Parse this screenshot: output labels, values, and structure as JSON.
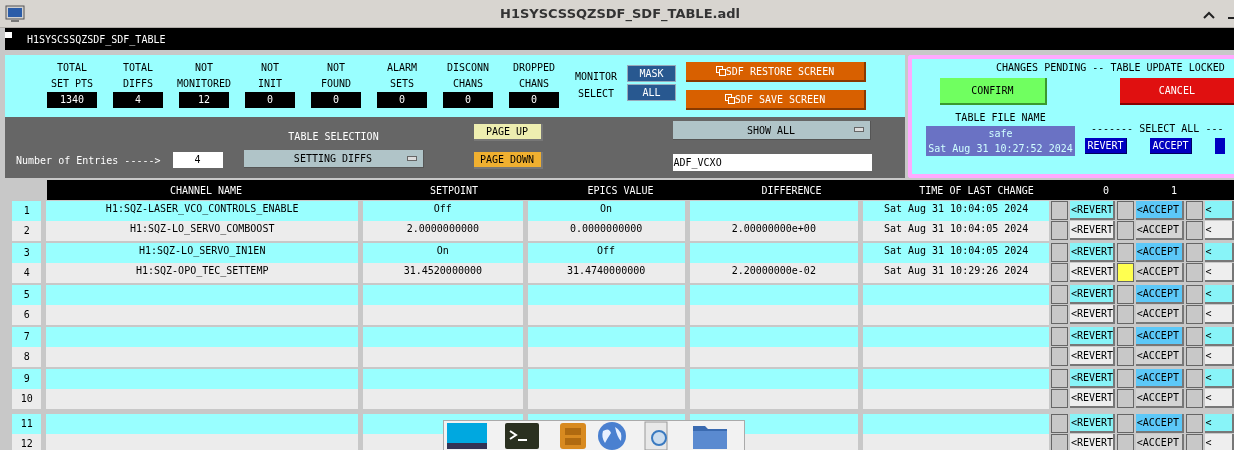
{
  "window": {
    "title": "H1SYSCSSQZSDF_SDF_TABLE.adl"
  },
  "screen_title": "H1SYSCSSQZSDF_SDF_TABLE",
  "counters": [
    {
      "label_lines": [
        "TOTAL",
        "SET PTS"
      ],
      "value": "1340"
    },
    {
      "label_lines": [
        "TOTAL",
        "DIFFS"
      ],
      "value": "4"
    },
    {
      "label_lines": [
        "NOT",
        "MONITORED"
      ],
      "value": "12"
    },
    {
      "label_lines": [
        "NOT",
        "INIT"
      ],
      "value": "0"
    },
    {
      "label_lines": [
        "NOT",
        "FOUND"
      ],
      "value": "0"
    },
    {
      "label_lines": [
        "ALARM",
        "SETS"
      ],
      "value": "0"
    },
    {
      "label_lines": [
        "DISCONN",
        "CHANS"
      ],
      "value": "0"
    },
    {
      "label_lines": [
        "DROPPED",
        "CHANS"
      ],
      "value": "0"
    }
  ],
  "monitor_select": {
    "label_lines": [
      "MONITOR",
      "SELECT"
    ],
    "buttons": [
      "MASK",
      "ALL"
    ]
  },
  "screen_buttons": [
    "SDF RESTORE SCREEN",
    "SDF SAVE SCREEN"
  ],
  "entries": {
    "label": "Number of Entries ----->",
    "value": "4"
  },
  "table_selection": {
    "label": "TABLE SELECTION",
    "value": "SETTING DIFFS"
  },
  "page_buttons": [
    {
      "label": "PAGE UP",
      "kind": "up"
    },
    {
      "label": "PAGE DOWN",
      "kind": "down"
    }
  ],
  "show_menu": {
    "value": "SHOW ALL"
  },
  "filter_field": {
    "value": "ADF_VCXO"
  },
  "pending": {
    "message": "CHANGES PENDING -- TABLE UPDATE LOCKED",
    "confirm": "CONFIRM",
    "cancel": "CANCEL",
    "file_label": "TABLE FILE NAME",
    "file_name": "safe",
    "file_time": "Sat Aug 31 10:27:52 2024",
    "select_all_label": "------- SELECT ALL ---",
    "select_buttons": [
      "REVERT",
      "ACCEPT"
    ]
  },
  "table": {
    "columns": [
      "CHANNEL NAME",
      "SETPOINT",
      "EPICS VALUE",
      "DIFFERENCE",
      "TIME OF LAST CHANGE",
      "0",
      "1"
    ],
    "rows": [
      {
        "index": "1",
        "channel": "H1:SQZ-LASER_VCO_CONTROLS_ENABLE",
        "setpoint": "Off",
        "epics_value": "On",
        "time": "Sat Aug 31 10:04:05 2024",
        "actions": [
          {
            "label": "<REVERT",
            "checked": false
          },
          {
            "label": "<ACCEPT",
            "checked": false
          },
          {
            "label": "<",
            "checked": false
          }
        ]
      },
      {
        "index": "2",
        "channel": "H1:SQZ-LO_SERVO_COMBOOST",
        "setpoint": "2.0000000000",
        "epics_value": "0.0000000000",
        "difference": "2.00000000e+00",
        "time": "Sat Aug 31 10:04:05 2024",
        "actions": [
          {
            "label": "<REVERT",
            "checked": false
          },
          {
            "label": "<ACCEPT",
            "checked": false
          },
          {
            "label": "<",
            "checked": false
          }
        ]
      },
      {
        "index": "3",
        "channel": "H1:SQZ-LO_SERVO_IN1EN",
        "setpoint": "On",
        "epics_value": "Off",
        "time": "Sat Aug 31 10:04:05 2024",
        "actions": [
          {
            "label": "<REVERT",
            "checked": false
          },
          {
            "label": "<ACCEPT",
            "checked": false
          },
          {
            "label": "<",
            "checked": false
          }
        ]
      },
      {
        "index": "4",
        "channel": "H1:SQZ-OPO_TEC_SETTEMP",
        "setpoint": "31.4520000000",
        "epics_value": "31.4740000000",
        "difference": "2.20000000e-02",
        "time": "Sat Aug 31 10:29:26 2024",
        "actions": [
          {
            "label": "<REVERT",
            "checked": false
          },
          {
            "label": "<ACCEPT",
            "checked": true
          },
          {
            "label": "<",
            "checked": false
          }
        ]
      },
      {
        "index": "5",
        "actions": [
          {
            "label": "<REVERT",
            "checked": false
          },
          {
            "label": "<ACCEPT",
            "checked": false
          },
          {
            "label": "<",
            "checked": false
          }
        ]
      },
      {
        "index": "6",
        "actions": [
          {
            "label": "<REVERT",
            "checked": false
          },
          {
            "label": "<ACCEPT",
            "checked": false
          },
          {
            "label": "<",
            "checked": false
          }
        ]
      },
      {
        "index": "7",
        "actions": [
          {
            "label": "<REVERT",
            "checked": false
          },
          {
            "label": "<ACCEPT",
            "checked": false
          },
          {
            "label": "<",
            "checked": false
          }
        ]
      },
      {
        "index": "8",
        "actions": [
          {
            "label": "<REVERT",
            "checked": false
          },
          {
            "label": "<ACCEPT",
            "checked": false
          },
          {
            "label": "<",
            "checked": false
          }
        ]
      },
      {
        "index": "9",
        "actions": [
          {
            "label": "<REVERT",
            "checked": false
          },
          {
            "label": "<ACCEPT",
            "checked": false
          },
          {
            "label": "<",
            "checked": false
          }
        ]
      },
      {
        "index": "10",
        "actions": [
          {
            "label": "<REVERT",
            "checked": false
          },
          {
            "label": "<ACCEPT",
            "checked": false
          },
          {
            "label": "<",
            "checked": false
          }
        ]
      },
      {
        "index": "11",
        "actions": [
          {
            "label": "<REVERT",
            "checked": false
          },
          {
            "label": "<ACCEPT",
            "checked": false
          },
          {
            "label": "<",
            "checked": false
          }
        ]
      },
      {
        "index": "12",
        "actions": [
          {
            "label": "<REVERT",
            "checked": false
          },
          {
            "label": "<ACCEPT",
            "checked": false
          },
          {
            "label": "<",
            "checked": false
          }
        ]
      }
    ]
  }
}
